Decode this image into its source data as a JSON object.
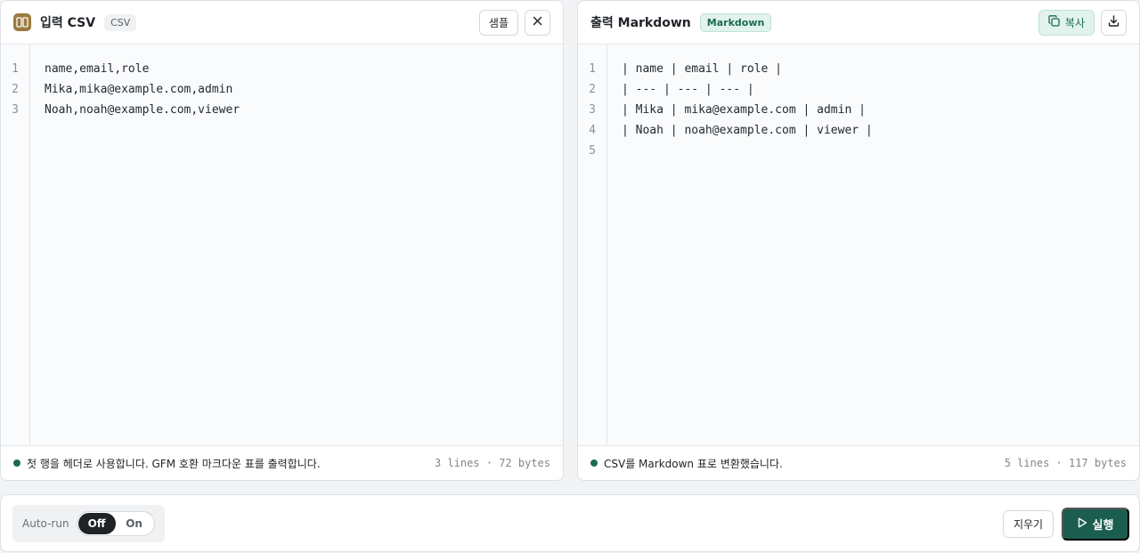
{
  "input_panel": {
    "title": "입력 CSV",
    "badge": "CSV",
    "sample_button": "샘플",
    "icon": "book-icon",
    "lines": [
      "name,email,role",
      "Mika,mika@example.com,admin",
      "Noah,noah@example.com,viewer"
    ],
    "line_numbers": [
      "1",
      "2",
      "3"
    ],
    "status": "첫 행을 헤더로 사용합니다. GFM 호환 마크다운 표를 출력합니다.",
    "stats": "3 lines · 72 bytes"
  },
  "output_panel": {
    "title": "출력 Markdown",
    "badge": "Markdown",
    "copy_button": "복사",
    "lines": [
      "| name | email | role |",
      "| --- | --- | --- |",
      "| Mika | mika@example.com | admin |",
      "| Noah | noah@example.com | viewer |",
      ""
    ],
    "line_numbers": [
      "1",
      "2",
      "3",
      "4",
      "5"
    ],
    "status": "CSV를 Markdown 표로 변환했습니다.",
    "stats": "5 lines · 117 bytes"
  },
  "footer": {
    "autorun_label": "Auto-run",
    "off_label": "Off",
    "on_label": "On",
    "autorun_state": "Off",
    "clear_button": "지우기",
    "run_button": "실행"
  },
  "colors": {
    "accent": "#1b5e50",
    "accent_light": "#e2f2ec",
    "status_dot": "#1b6a55"
  }
}
